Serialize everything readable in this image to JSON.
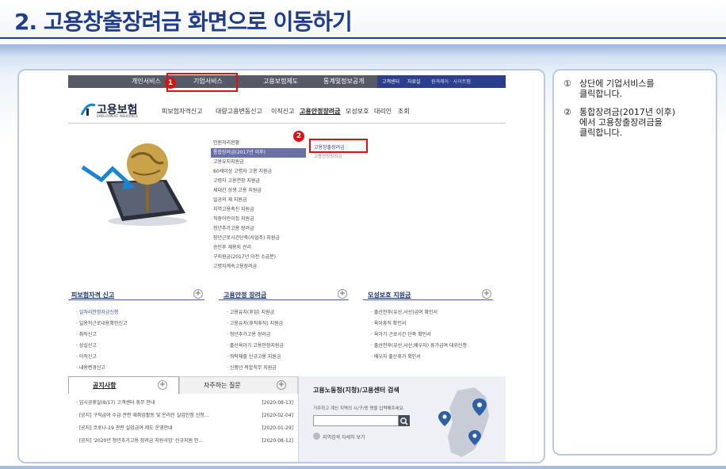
{
  "page": {
    "title": "2. 고용창출장려금 화면으로 이동하기"
  },
  "site": {
    "topnav": {
      "items": [
        "개인서비스",
        "기업서비스",
        "고용보험제도",
        "통계및정보공개"
      ],
      "right": [
        "고객센터",
        "자료실",
        "원격제어 · 사이트맵"
      ]
    },
    "logo": {
      "name": "고용보험",
      "sub": "EMPLOYMENT INSURANCE"
    },
    "menu": [
      "피보험자격신고",
      "대량고용변동신고",
      "이직신고",
      "고용안정장려금",
      "모성보호",
      "대리인",
      "조회"
    ],
    "dropdown": {
      "items": [
        "민원처리현황",
        "통합장려금(2017년 이후)",
        "고용유지지원금",
        "60세이상 고령자 고용 지원금",
        "고령자 고용연장 지원금",
        "세대간 상생 고용 지원금",
        "일공의 재 지원금",
        "지역고용촉진 지원금",
        "직장어린이집 지원금",
        "청년추가고용 장려금",
        "장년근로시간단축(사업주) 지원금",
        "승인후 재용의 관리",
        "구지원금(2017년 이전 소급분)",
        "고령자계속고용장려금"
      ],
      "selected_index": 1,
      "sub_items": [
        "고용창출장려금",
        "고용안정장려금"
      ]
    },
    "panels": [
      {
        "title": "피보험자격 신고",
        "items": [
          "일자리안정자금신청",
          "일용직근로내용확인신고",
          "취득신고",
          "상실신고",
          "이직신고",
          "내용변경신고"
        ],
        "highlight_index": 0
      },
      {
        "title": "고용안정 장려금",
        "items": [
          "고용유지(휴업) 지원금",
          "고용유지(휴직휴직) 지원금",
          "청년추가고용 장려금",
          "출산육아기 고용안정지원금",
          "워탁체졸 신규고용 지원금",
          "신중년 적합직무 지원금"
        ],
        "highlight_index": -1
      },
      {
        "title": "모성보호 지원금",
        "items": [
          "출산전후(유산,사산)급여 확인서",
          "육아휴직 확인서",
          "육아기 근로시간 단축 확인서",
          "출산전후(유산,사산,배우자) 휴가급여 대위신청",
          "배우자 출산휴가 확인서"
        ],
        "highlight_index": -1
      }
    ],
    "notices": {
      "tabs": [
        "공지사항",
        "자주하는 질문"
      ],
      "rows": [
        {
          "text": "임시공휴일(8/17) 고객센터 휴무 안내",
          "date": "[2020-08-13]"
        },
        {
          "text": "[공지] 구직급여 수급 관련 재취업활동 및 온라인 실업인정 신청...",
          "date": "[2020-02-04]"
        },
        {
          "text": "[공지] 코로나-19 관련 실업급여 제도 운영안내",
          "date": "[2020-01-29]"
        },
        {
          "text": "[공지] '2020년 청년추가고용 장려금 지원사업' 신규지원 안...",
          "date": "[2020-08-12]"
        }
      ]
    },
    "center_search": {
      "title": "고용노동청(지청)/고용센터 검색",
      "desc": "거주하고 계신 지역의 시/구/동 명을 입력해주세요.",
      "detail": "지역검색 자세히 보기"
    }
  },
  "badges": [
    "1",
    "2"
  ],
  "instructions": [
    {
      "num": "①",
      "text": "상단에 기업서비스를\n클릭합니다."
    },
    {
      "num": "②",
      "text": "통합장려금(2017년 이후)\n에서 고용창출장려금을\n클릭합니다."
    }
  ]
}
